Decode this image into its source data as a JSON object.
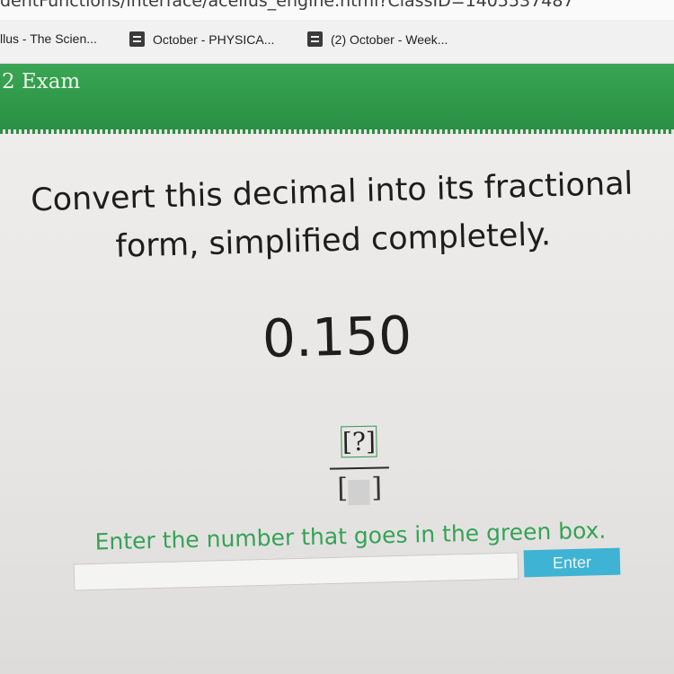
{
  "browser": {
    "url_fragment": "dentFunctions/interface/acellus_engine.html?ClassID=1405537487"
  },
  "bookmarks": [
    {
      "label": "llus - The Scien...",
      "icon": ""
    },
    {
      "label": "October - PHYSICA...",
      "icon": "document-icon"
    },
    {
      "label": "(2) October - Week...",
      "icon": "document-icon"
    }
  ],
  "header": {
    "title": "2 Exam",
    "color": "#2e9a4a"
  },
  "problem": {
    "prompt": "Convert this decimal into its fractional form, simplified completely.",
    "decimal": "0.150",
    "numerator_placeholder": "[?]",
    "denominator_left_bracket": "[",
    "denominator_right_bracket": "]",
    "instruction": "Enter the number that goes in the green box."
  },
  "answer": {
    "value": "",
    "enter_label": "Enter",
    "enter_color": "#3fb3d3"
  }
}
